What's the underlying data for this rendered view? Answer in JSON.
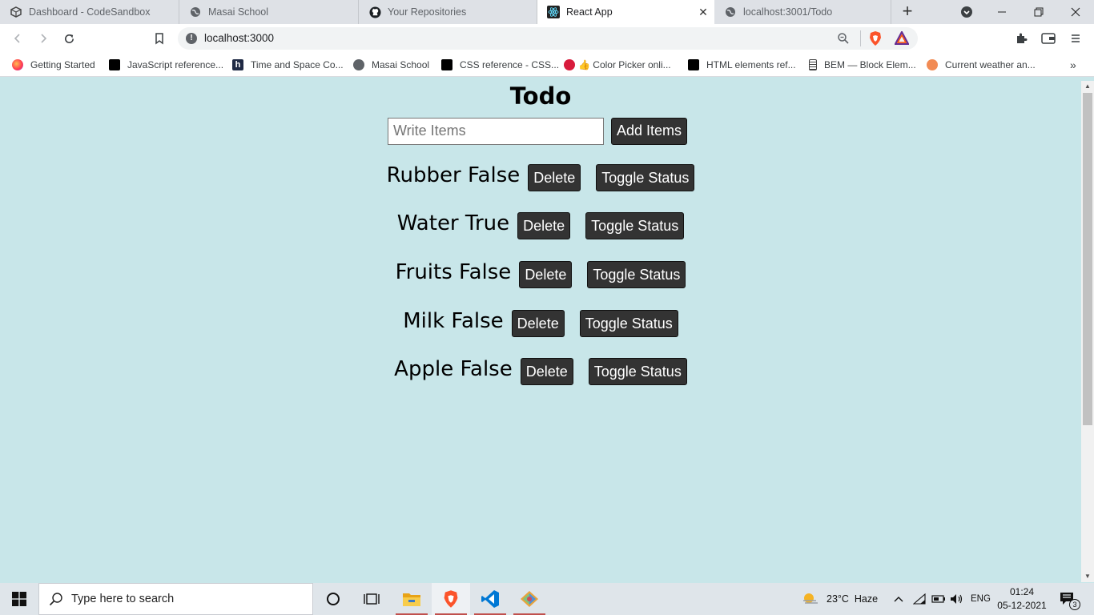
{
  "browser": {
    "tabs": [
      {
        "title": "Dashboard - CodeSandbox",
        "icon": "codesandbox-icon"
      },
      {
        "title": "Masai School",
        "icon": "globe-icon"
      },
      {
        "title": "Your Repositories",
        "icon": "github-icon"
      },
      {
        "title": "React App",
        "icon": "react-icon",
        "active": true
      },
      {
        "title": "localhost:3001/Todo",
        "icon": "globe-icon"
      }
    ],
    "url": "localhost:3000",
    "bookmarks": [
      {
        "label": "Getting Started"
      },
      {
        "label": "JavaScript reference..."
      },
      {
        "label": "Time and Space Co..."
      },
      {
        "label": "Masai School"
      },
      {
        "label": "CSS reference - CSS..."
      },
      {
        "label": "👍 Color Picker onli..."
      },
      {
        "label": "HTML elements ref..."
      },
      {
        "label": "BEM — Block Elem..."
      },
      {
        "label": "Current weather an..."
      }
    ]
  },
  "app": {
    "title": "Todo",
    "input_placeholder": "Write Items",
    "add_label": "Add Items",
    "items": [
      {
        "text": "Rubber False",
        "delete_label": "Delete",
        "toggle_label": "Toggle Status"
      },
      {
        "text": "Water True",
        "delete_label": "Delete",
        "toggle_label": "Toggle Status"
      },
      {
        "text": "Fruits False",
        "delete_label": "Delete",
        "toggle_label": "Toggle Status"
      },
      {
        "text": "Milk False",
        "delete_label": "Delete",
        "toggle_label": "Toggle Status"
      },
      {
        "text": "Apple False",
        "delete_label": "Delete",
        "toggle_label": "Toggle Status"
      }
    ]
  },
  "taskbar": {
    "search_placeholder": "Type here to search",
    "weather": "23°C  Haze",
    "language": "ENG",
    "time": "01:24",
    "date": "05-12-2021",
    "notification_count": "3"
  },
  "colors": {
    "page_background": "#c8e6e9",
    "button_background": "#333333",
    "button_text": "#ffffff"
  }
}
